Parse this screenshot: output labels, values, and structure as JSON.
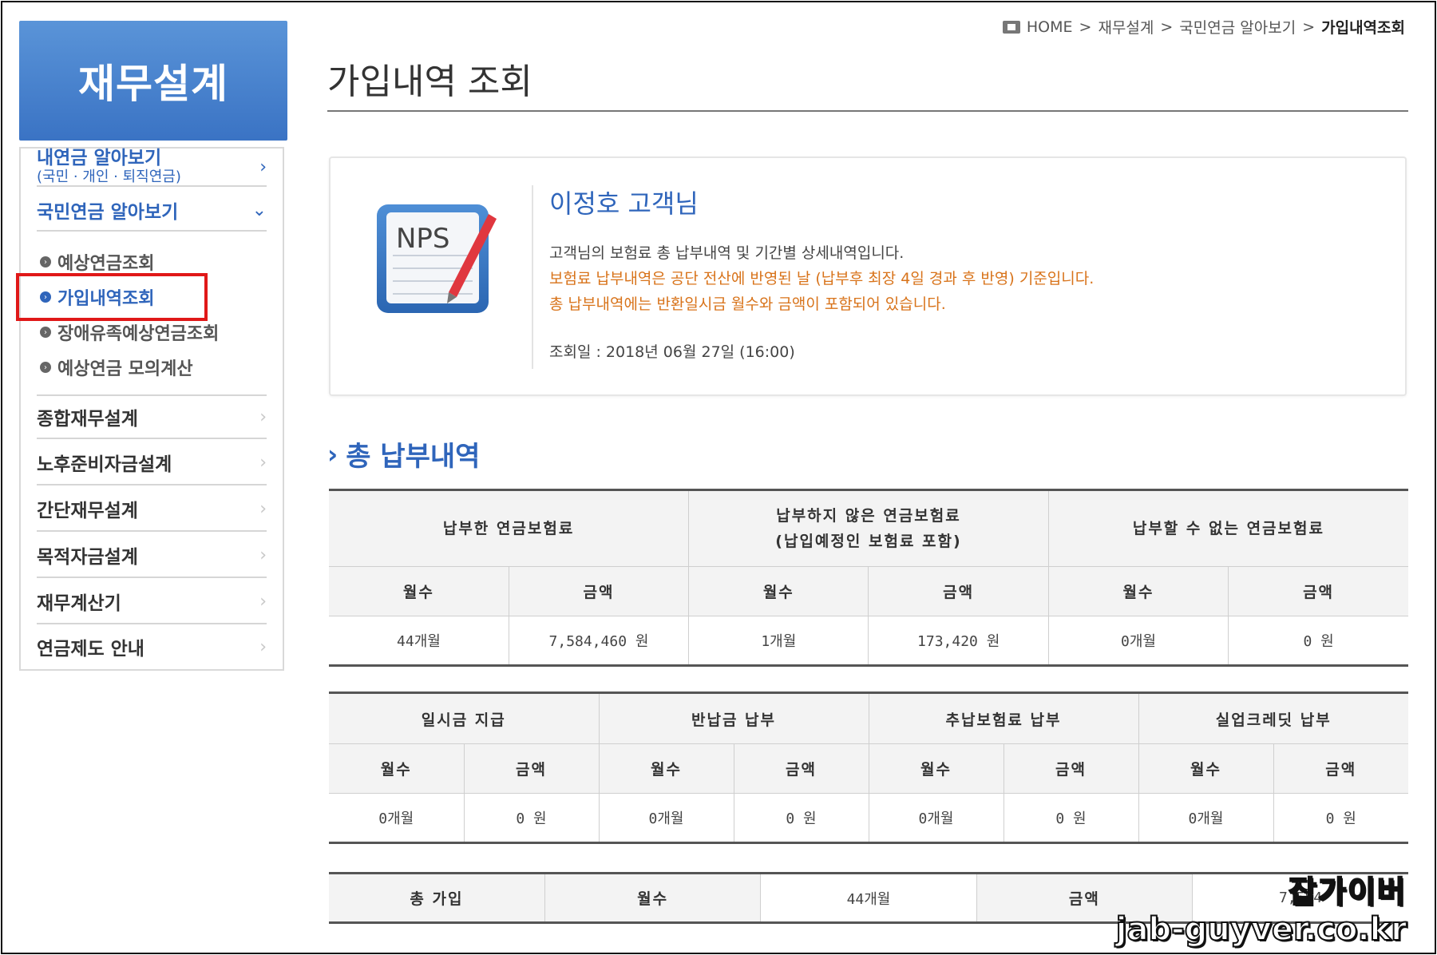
{
  "breadcrumb": {
    "home": "HOME",
    "sep": ">",
    "level1": "재무설계",
    "level2": "국민연금 알아보기",
    "current": "가입내역조회"
  },
  "page": {
    "title": "가입내역 조회"
  },
  "sidebar": {
    "header": "재무설계",
    "item_mypension": {
      "label": "내연금 알아보기",
      "sub": "(국민 · 개인 · 퇴직연금)"
    },
    "item_nps": {
      "label": "국민연금 알아보기"
    },
    "sub_items": [
      "예상연금조회",
      "가입내역조회",
      "장애유족예상연금조회",
      "예상연금 모의계산"
    ],
    "items": [
      "종합재무설계",
      "노후준비자금설계",
      "간단재무설계",
      "목적자금설계",
      "재무계산기",
      "연금제도 안내"
    ],
    "chevron": "›",
    "chevron_down": "⌄"
  },
  "info": {
    "icon_text": "NPS",
    "customer": "이정호 고객님",
    "line1": "고객님의 보험료 총 납부내역 및 기간별 상세내역입니다.",
    "line2": "보험료 납부내역은 공단 전산에 반영된 날 (납부후 최장 4일 경과 후 반영) 기준입니다.",
    "line3": "총 납부내역에는 반환일시금 월수와 금액이 포함되어 있습니다.",
    "query_date": "조회일 : 2018년 06월 27일 (16:00)"
  },
  "section": {
    "arrow": "›",
    "title": "총 납부내역"
  },
  "table1": {
    "groups": [
      {
        "l1": "납부한 연금보험료",
        "l2": ""
      },
      {
        "l1": "납부하지 않은 연금보험료",
        "l2": "(납입예정인 보험료 포함)"
      },
      {
        "l1": "납부할 수 없는 연금보험료",
        "l2": ""
      }
    ],
    "sub_month": "월수",
    "sub_amount": "금액",
    "values": [
      "44개월",
      "7,584,460 원",
      "1개월",
      "173,420 원",
      "0개월",
      "0 원"
    ]
  },
  "table2": {
    "groups": [
      "일시금 지급",
      "반납금 납부",
      "추납보험료 납부",
      "실업크레딧 납부"
    ],
    "sub_month": "월수",
    "sub_amount": "금액",
    "values": [
      "0개월",
      "0 원",
      "0개월",
      "0 원",
      "0개월",
      "0 원",
      "0개월",
      "0 원"
    ]
  },
  "table3": {
    "label": "총 가입",
    "month_label": "월수",
    "month_value": "44개월",
    "amount_label": "금액",
    "amount_value": "7,584"
  },
  "watermark": {
    "line1": "잡가이버",
    "line2": "jab-guyver.co.kr"
  },
  "colors": {
    "accent": "#2f65bb",
    "warning": "#d8731a",
    "highlight": "#e01818"
  }
}
